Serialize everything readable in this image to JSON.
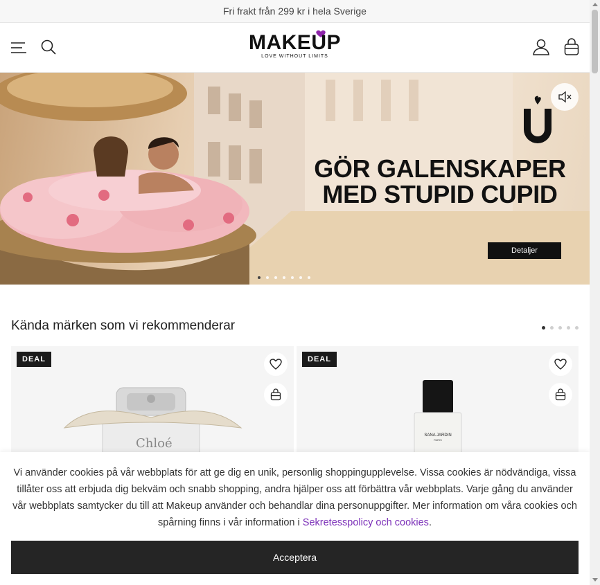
{
  "topbar": {
    "text": "Fri frakt från 299 kr i hela Sverige"
  },
  "header": {
    "logo_text": "MAKEUP",
    "logo_tagline": "LOVE WITHOUT LIMITS",
    "icons": [
      "menu-icon",
      "search-icon",
      "user-icon",
      "bag-icon"
    ]
  },
  "hero": {
    "brand_mark": "Ü",
    "title_line1": "GÖR GALENSKAPER",
    "title_line2": "MED STUPID CUPID",
    "button_label": "Detaljer",
    "slide_count": 7,
    "active_slide": 1
  },
  "recommended": {
    "title": "Kända märken som vi rekommenderar",
    "page_count": 5,
    "active_page": 1,
    "products": [
      {
        "badge": "DEAL",
        "brand_on_bottle": "Chloé"
      },
      {
        "badge": "DEAL",
        "brand_on_bottle": "SANA JARDIN",
        "sub_on_bottle": "PARIS"
      }
    ]
  },
  "cookie": {
    "text": "Vi använder cookies på vår webbplats för att ge dig en unik, personlig shoppingupplevelse. Vissa cookies är nödvändiga, vissa tillåter oss att erbjuda dig bekväm och snabb shopping, andra hjälper oss att förbättra vår webbplats. Varje gång du använder vår webbplats samtycker du till att Makeup använder och behandlar dina personuppgifter. Mer information om våra cookies och spårning finns i vår information i ",
    "link_text": "Sekretesspolicy och cookies",
    "after_link": ".",
    "accept_label": "Acceptera"
  },
  "colors": {
    "link": "#7b2fb8",
    "accent_heart": "#8e24aa",
    "button_dark": "#252525"
  }
}
